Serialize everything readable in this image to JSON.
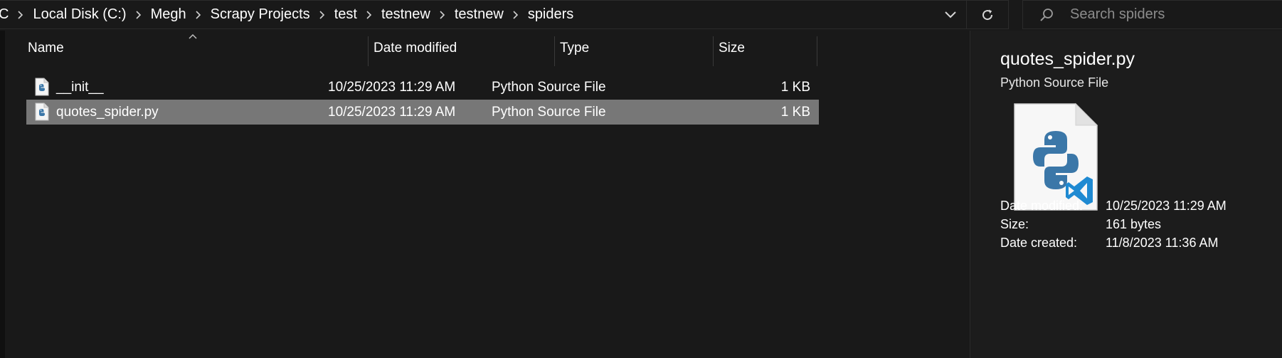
{
  "window": {
    "breadcrumbs": [
      "C",
      "Local Disk (C:)",
      "Megh",
      "Scrapy Projects",
      "test",
      "testnew",
      "testnew",
      "spiders"
    ],
    "search": {
      "placeholder": "Search spiders",
      "value": ""
    }
  },
  "columns": {
    "name": "Name",
    "date_modified": "Date modified",
    "type": "Type",
    "size": "Size"
  },
  "files": [
    {
      "name": "__init__",
      "date_modified": "10/25/2023 11:29 AM",
      "type": "Python Source File",
      "size": "1 KB",
      "icon": "python-file-icon",
      "selected": false
    },
    {
      "name": "quotes_spider.py",
      "date_modified": "10/25/2023 11:29 AM",
      "type": "Python Source File",
      "size": "1 KB",
      "icon": "python-file-icon",
      "selected": true
    }
  ],
  "details": {
    "name": "quotes_spider.py",
    "type": "Python Source File",
    "icon": "python-vscode-file-icon",
    "properties": [
      {
        "label": "Date modified:",
        "value": "10/25/2023 11:29 AM"
      },
      {
        "label": "Size:",
        "value": "161 bytes"
      },
      {
        "label": "Date created:",
        "value": "11/8/2023 11:36 AM"
      }
    ]
  },
  "colors": {
    "background": "#191919",
    "selection": "#777777",
    "python_blue": "#3b77a8",
    "vscode_blue": "#1f8ad2"
  }
}
